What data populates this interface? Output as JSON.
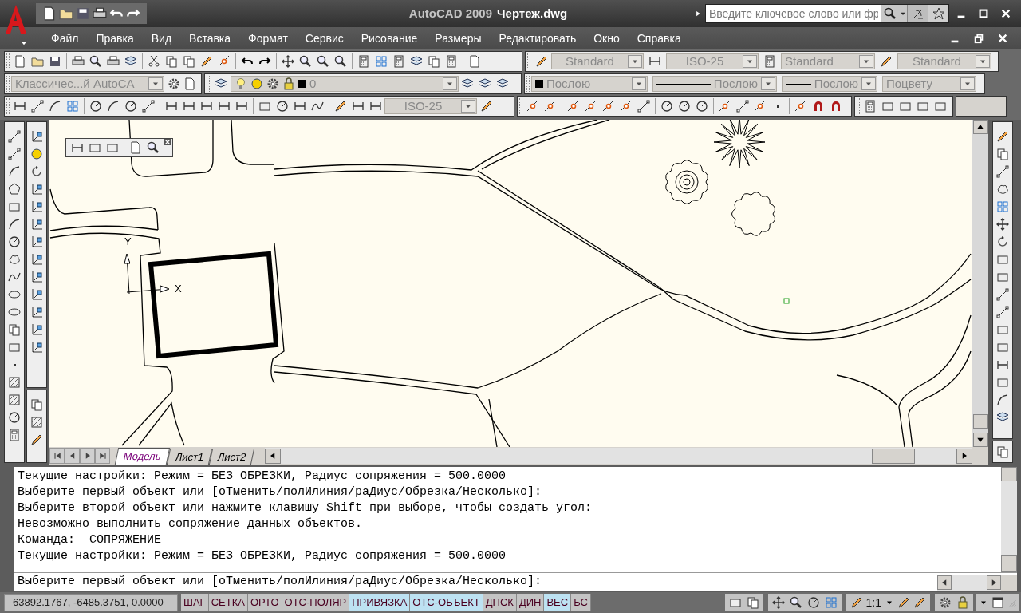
{
  "window": {
    "app": "AutoCAD 2009",
    "document": "Чертеж.dwg"
  },
  "search": {
    "placeholder": "Введите ключевое слово или фр"
  },
  "menu": [
    {
      "label": "Файл"
    },
    {
      "label": "Правка"
    },
    {
      "label": "Вид"
    },
    {
      "label": "Вставка"
    },
    {
      "label": "Формат"
    },
    {
      "label": "Сервис"
    },
    {
      "label": "Рисование"
    },
    {
      "label": "Размеры"
    },
    {
      "label": "Редактировать"
    },
    {
      "label": "Окно"
    },
    {
      "label": "Справка"
    }
  ],
  "styles_toolbar": {
    "text_style": "Standard",
    "dim_style": "ISO-25",
    "table_style": "Standard",
    "multileader_style": "Standard"
  },
  "workspace": {
    "value": "Классичес...й AutoCA"
  },
  "layer": {
    "value": "0"
  },
  "properties": {
    "color_setting": "Послою",
    "linetype": "Послою",
    "lineweight": "Послою",
    "plot_style": "Поцвету"
  },
  "dimension_toolbar": {
    "dim_style": "ISO-25"
  },
  "ucs_labels": {
    "x": "X",
    "y": "Y"
  },
  "layout_tabs": [
    {
      "label": "Модель",
      "selected": true
    },
    {
      "label": "Лист1",
      "selected": false
    },
    {
      "label": "Лист2",
      "selected": false
    }
  ],
  "command_history": [
    "Текущие настройки: Режим = БЕЗ ОБРЕЗКИ, Радиус сопряжения = 500.0000",
    "Выберите первый объект или [оТменить/полИлиния/раДиус/Обрезка/Несколько]:",
    "Выберите второй объект или нажмите клавишу Shift при выборе, чтобы создать угол:",
    "Невозможно выполнить сопряжение данных объектов.",
    "Команда:  СОПРЯЖЕНИЕ",
    "Текущие настройки: Режим = БЕЗ ОБРЕЗКИ, Радиус сопряжения = 500.0000"
  ],
  "command_input": "Выберите первый объект или [оТменить/полИлиния/раДиус/Обрезка/Несколько]:",
  "status_bar": {
    "coordinates": "63892.1767, -6485.3751, 0.0000",
    "toggles": [
      {
        "label": "ШАГ",
        "on": false
      },
      {
        "label": "СЕТКА",
        "on": false
      },
      {
        "label": "ОРТО",
        "on": false
      },
      {
        "label": "ОТС-ПОЛЯР",
        "on": false
      },
      {
        "label": "ПРИВЯЗКА",
        "on": true
      },
      {
        "label": "ОТС-ОБЪЕКТ",
        "on": true
      },
      {
        "label": "ДПСК",
        "on": false
      },
      {
        "label": "ДИН",
        "on": false
      },
      {
        "label": "ВЕС",
        "on": true
      },
      {
        "label": "БС",
        "on": false
      }
    ],
    "annotation_scale": "1:1"
  }
}
